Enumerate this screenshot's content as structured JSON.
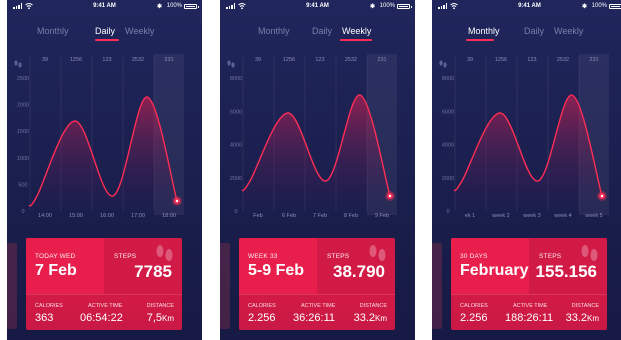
{
  "status_bar": {
    "time": "9:41 AM",
    "battery": "100%"
  },
  "tab_labels": [
    "Monthly",
    "Daily",
    "Weekly"
  ],
  "colors": {
    "accent": "#ff2d55",
    "background": "#1d2254",
    "card": "#e41b48"
  },
  "screens": [
    {
      "active_tab": "Daily",
      "card": {
        "period_label": "TODAY WED",
        "period_value": "7 Feb",
        "steps_label": "STEPS",
        "steps_value": "7785",
        "calories_label": "CALORIES",
        "calories_value": "363",
        "active_time_label": "ACTIVE TIME",
        "active_time_value": "06:54:22",
        "distance_label": "DISTANCE",
        "distance_value": "7,5",
        "distance_unit": "Km"
      },
      "chart_data": {
        "type": "line",
        "top_labels": [
          "39",
          "1256",
          "123",
          "2532",
          "231"
        ],
        "y_ticks": [
          "2500",
          "2000",
          "1500",
          "1000",
          "500",
          "0"
        ],
        "x_labels": [
          "14:00",
          "15:00",
          "16:00",
          "17:00",
          "18:00"
        ],
        "ylim": [
          0,
          2500
        ],
        "values": [
          280,
          1700,
          280,
          2150,
          180
        ]
      }
    },
    {
      "active_tab": "Weekly",
      "card": {
        "period_label": "WEEK 33",
        "period_value": "5-9 Feb",
        "steps_label": "STEPS",
        "steps_value": "38.790",
        "calories_label": "CALORIES",
        "calories_value": "2.256",
        "active_time_label": "ACTIVE TIME",
        "active_time_value": "36:26:11",
        "distance_label": "DISTANCE",
        "distance_value": "33.2",
        "distance_unit": "Km"
      },
      "chart_data": {
        "type": "line",
        "top_labels": [
          "39",
          "1256",
          "123",
          "2532",
          "231"
        ],
        "y_ticks": [
          "8000",
          "6000",
          "4000",
          "2000",
          "0"
        ],
        "x_labels": [
          "Feb",
          "6 Feb",
          "7 Feb",
          "8 Feb",
          "9 Feb"
        ],
        "ylim": [
          0,
          8000
        ],
        "values": [
          1800,
          5900,
          1800,
          7000,
          900
        ]
      }
    },
    {
      "active_tab": "Monthly",
      "card": {
        "period_label": "30 Days",
        "period_value": "February",
        "steps_label": "STEPS",
        "steps_value": "155.156",
        "calories_label": "CALORIES",
        "calories_value": "2.256",
        "active_time_label": "ACTIVE TIME",
        "active_time_value": "188:26:11",
        "distance_label": "DISTANCE",
        "distance_value": "33.2",
        "distance_unit": "Km"
      },
      "chart_data": {
        "type": "line",
        "top_labels": [
          "39",
          "1256",
          "123",
          "2532",
          "231"
        ],
        "y_ticks": [
          "8000",
          "6000",
          "4000",
          "2000",
          "0"
        ],
        "x_labels": [
          "ek 1",
          "week 2",
          "week 3",
          "week 4",
          "week 5"
        ],
        "ylim": [
          0,
          8000
        ],
        "values": [
          1800,
          5900,
          1800,
          7000,
          900
        ]
      }
    }
  ]
}
